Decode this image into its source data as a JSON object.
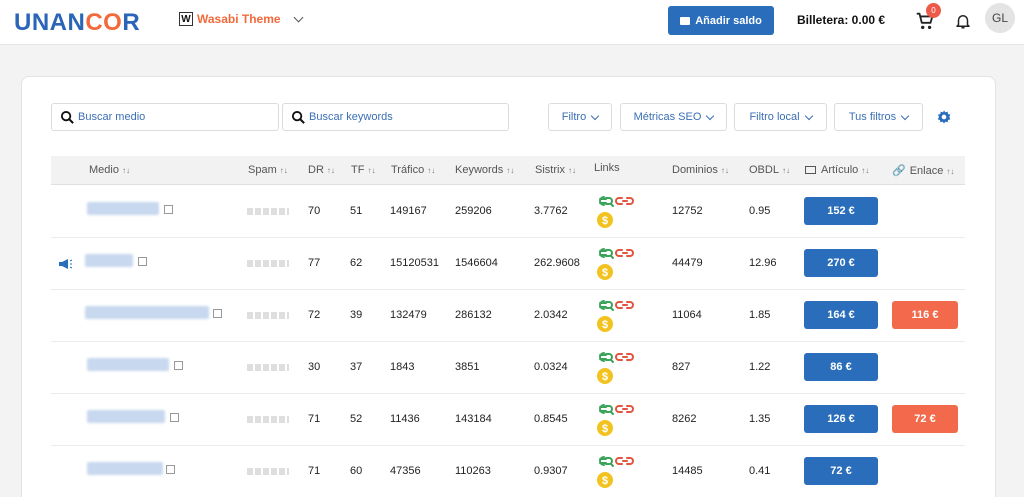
{
  "header": {
    "logo_left": "UNAN",
    "logo_accent": "CO",
    "logo_right": "R",
    "project_icon": "W",
    "project_name": "Wasabi Theme",
    "add_balance_label": "Añadir saldo",
    "wallet_label": "Billetera: 0.00 €",
    "cart_count": "0",
    "avatar_initials": "GL"
  },
  "filters": {
    "search_medio_placeholder": "Buscar medio",
    "search_keywords_placeholder": "Buscar keywords",
    "filtro": "Filtro",
    "metricas": "Métricas SEO",
    "filtro_local": "Filtro local",
    "tus_filtros": "Tus filtros"
  },
  "table": {
    "columns": {
      "medio": "Medio",
      "spam": "Spam",
      "dr": "DR",
      "tf": "TF",
      "trafico": "Tráfico",
      "keywords": "Keywords",
      "sistrix": "Sistrix",
      "links": "Links",
      "dominios": "Dominios",
      "obdl": "OBDL",
      "articulo": "Artículo",
      "enlace": "Enlace"
    },
    "rows": [
      {
        "dr": "70",
        "tf": "51",
        "trafico": "149167",
        "keywords": "259206",
        "sistrix": "3.7762",
        "dominios": "12752",
        "obdl": "0.95",
        "articulo": "152 €",
        "enlace": ""
      },
      {
        "dr": "77",
        "tf": "62",
        "trafico": "15120531",
        "keywords": "1546604",
        "sistrix": "262.9608",
        "dominios": "44479",
        "obdl": "12.96",
        "articulo": "270 €",
        "enlace": ""
      },
      {
        "dr": "72",
        "tf": "39",
        "trafico": "132479",
        "keywords": "286132",
        "sistrix": "2.0342",
        "dominios": "11064",
        "obdl": "1.85",
        "articulo": "164 €",
        "enlace": "116 €"
      },
      {
        "dr": "30",
        "tf": "37",
        "trafico": "1843",
        "keywords": "3851",
        "sistrix": "0.0324",
        "dominios": "827",
        "obdl": "1.22",
        "articulo": "86 €",
        "enlace": ""
      },
      {
        "dr": "71",
        "tf": "52",
        "trafico": "11436",
        "keywords": "143184",
        "sistrix": "0.8545",
        "dominios": "8262",
        "obdl": "1.35",
        "articulo": "126 €",
        "enlace": "72 €"
      },
      {
        "dr": "71",
        "tf": "60",
        "trafico": "47356",
        "keywords": "110263",
        "sistrix": "0.9307",
        "dominios": "14485",
        "obdl": "0.41",
        "articulo": "72 €",
        "enlace": ""
      }
    ]
  },
  "colors": {
    "primary": "#2a6ebb",
    "accent": "#f26a4b",
    "link_green": "#3aa35a",
    "link_red": "#e2553f",
    "coin": "#f2c320"
  }
}
